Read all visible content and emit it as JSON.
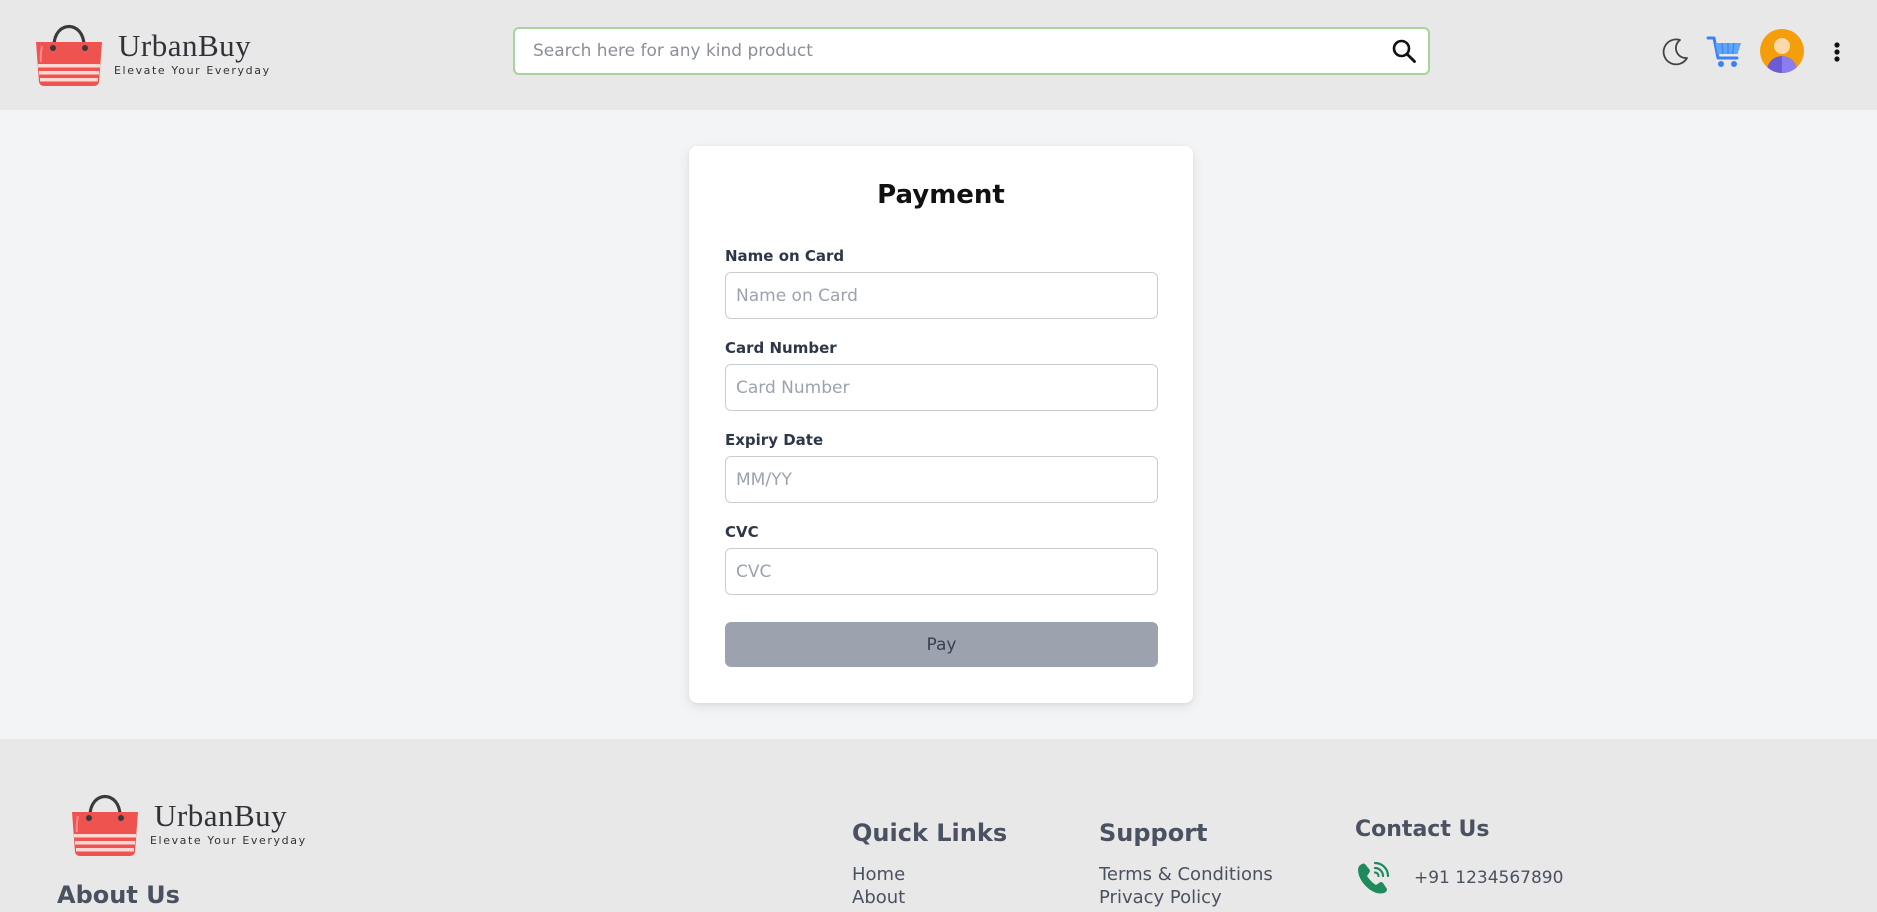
{
  "header": {
    "brand": {
      "name": "UrbanBuy",
      "tagline": "Elevate Your Everyday"
    },
    "search": {
      "placeholder": "Search here for any kind product",
      "value": "",
      "icon": "search-icon"
    },
    "icons": {
      "theme": "moon-icon",
      "cart": "cart-icon",
      "avatar": "user-avatar",
      "menu": "more-vertical-icon"
    }
  },
  "payment": {
    "title": "Payment",
    "fields": [
      {
        "label": "Name on Card",
        "placeholder": "Name on Card",
        "value": ""
      },
      {
        "label": "Card Number",
        "placeholder": "Card Number",
        "value": ""
      },
      {
        "label": "Expiry Date",
        "placeholder": "MM/YY",
        "value": ""
      },
      {
        "label": "CVC",
        "placeholder": "CVC",
        "value": ""
      }
    ],
    "submit_label": "Pay"
  },
  "footer": {
    "brand": {
      "name": "UrbanBuy",
      "tagline": "Elevate Your Everyday"
    },
    "about_heading": "About Us",
    "quick_links": {
      "heading": "Quick Links",
      "items": [
        "Home",
        "About"
      ]
    },
    "support": {
      "heading": "Support",
      "items": [
        "Terms & Conditions",
        "Privacy Policy"
      ]
    },
    "contact": {
      "heading": "Contact Us",
      "phone": "+91 1234567890",
      "icon": "phone-icon"
    }
  },
  "colors": {
    "header_bg": "#e8e8e8",
    "page_bg": "#f3f4f6",
    "search_border": "#a8d39a",
    "cart_blue": "#3b82f6",
    "bag_red": "#ef5350",
    "pay_button": "#9ca3af",
    "phone_green": "#1f8a5b"
  }
}
